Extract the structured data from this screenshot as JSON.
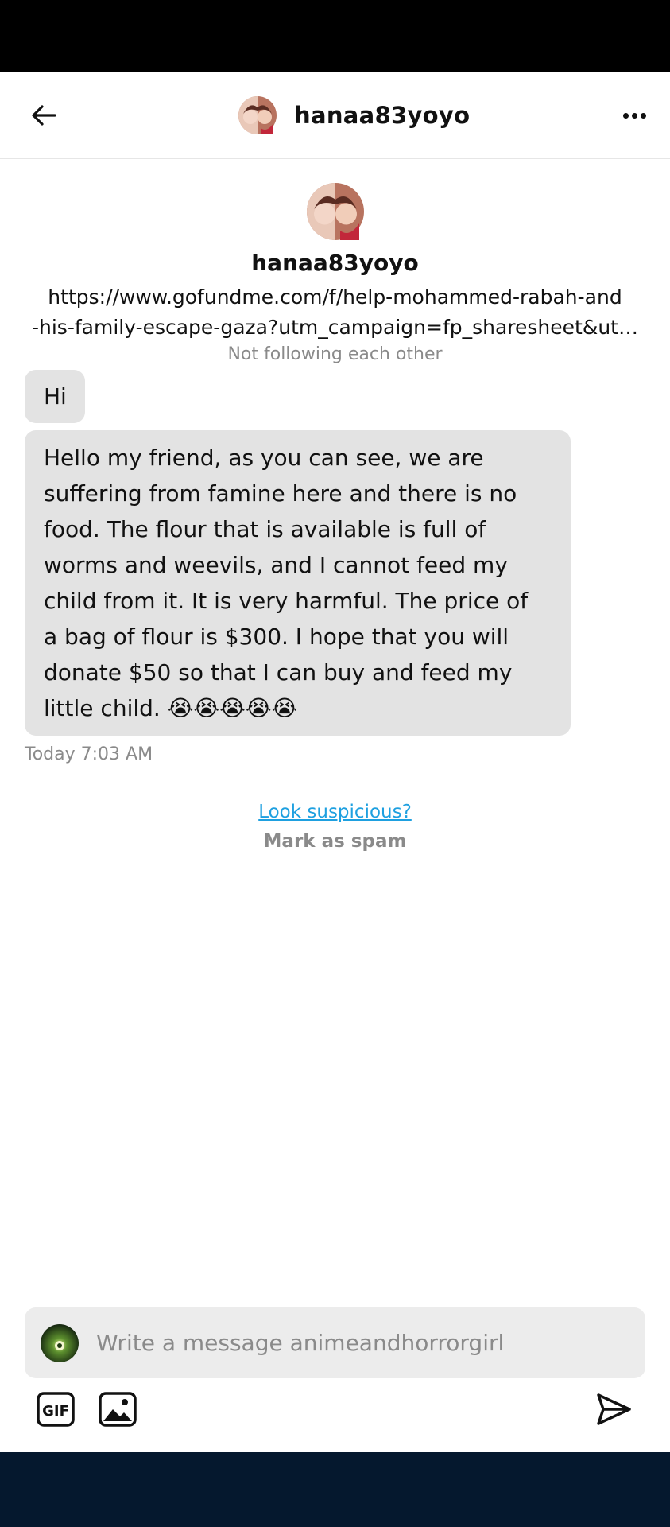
{
  "header": {
    "username": "hanaa83yoyo",
    "back_icon": "arrow-left-icon",
    "more_icon": "ellipsis-icon"
  },
  "profile": {
    "username": "hanaa83yoyo",
    "link_line1": "https://www.gofundme.com/f/help-mohammed-rabah-and",
    "link_line2": "-his-family-escape-gaza?utm_campaign=fp_sharesheet&ut…",
    "follow_status": "Not following each other"
  },
  "messages": [
    {
      "text": "Hi"
    },
    {
      "text": "Hello my friend, as you can see, we are suffering from famine here and there is no food. The flour that is available is full of worms and weevils, and I cannot feed my child from it. It is very harmful. The price of a bag of flour is $300. I hope that you will donate $50 so that I can buy and feed my little child. 😭😭😭😭😭"
    }
  ],
  "message_lines": [
    "Hello my friend, as you can see, we are",
    "suffering from famine here and there is no",
    "food. The flour that is available is full of",
    "worms and weevils, and I cannot feed my",
    "child from it. It is very harmful. The price of",
    "a bag of flour is $300. I hope that you will",
    "donate $50 so that I can buy and feed my",
    "little child. 😭😭😭😭😭"
  ],
  "timestamp": "Today 7:03 AM",
  "spam_prompt": {
    "link": "Look suspicious?",
    "action": "Mark as spam"
  },
  "composer": {
    "placeholder": "Write a message animeandhorrorgirl",
    "value": ""
  },
  "toolbar": {
    "gif_label": "GIF",
    "image_icon": "image-icon",
    "send_icon": "send-icon"
  },
  "colors": {
    "bubble": "#e3e3e3",
    "link": "#1ea0e0",
    "muted": "#8a8a8a",
    "nav_bar": "#05182e"
  }
}
